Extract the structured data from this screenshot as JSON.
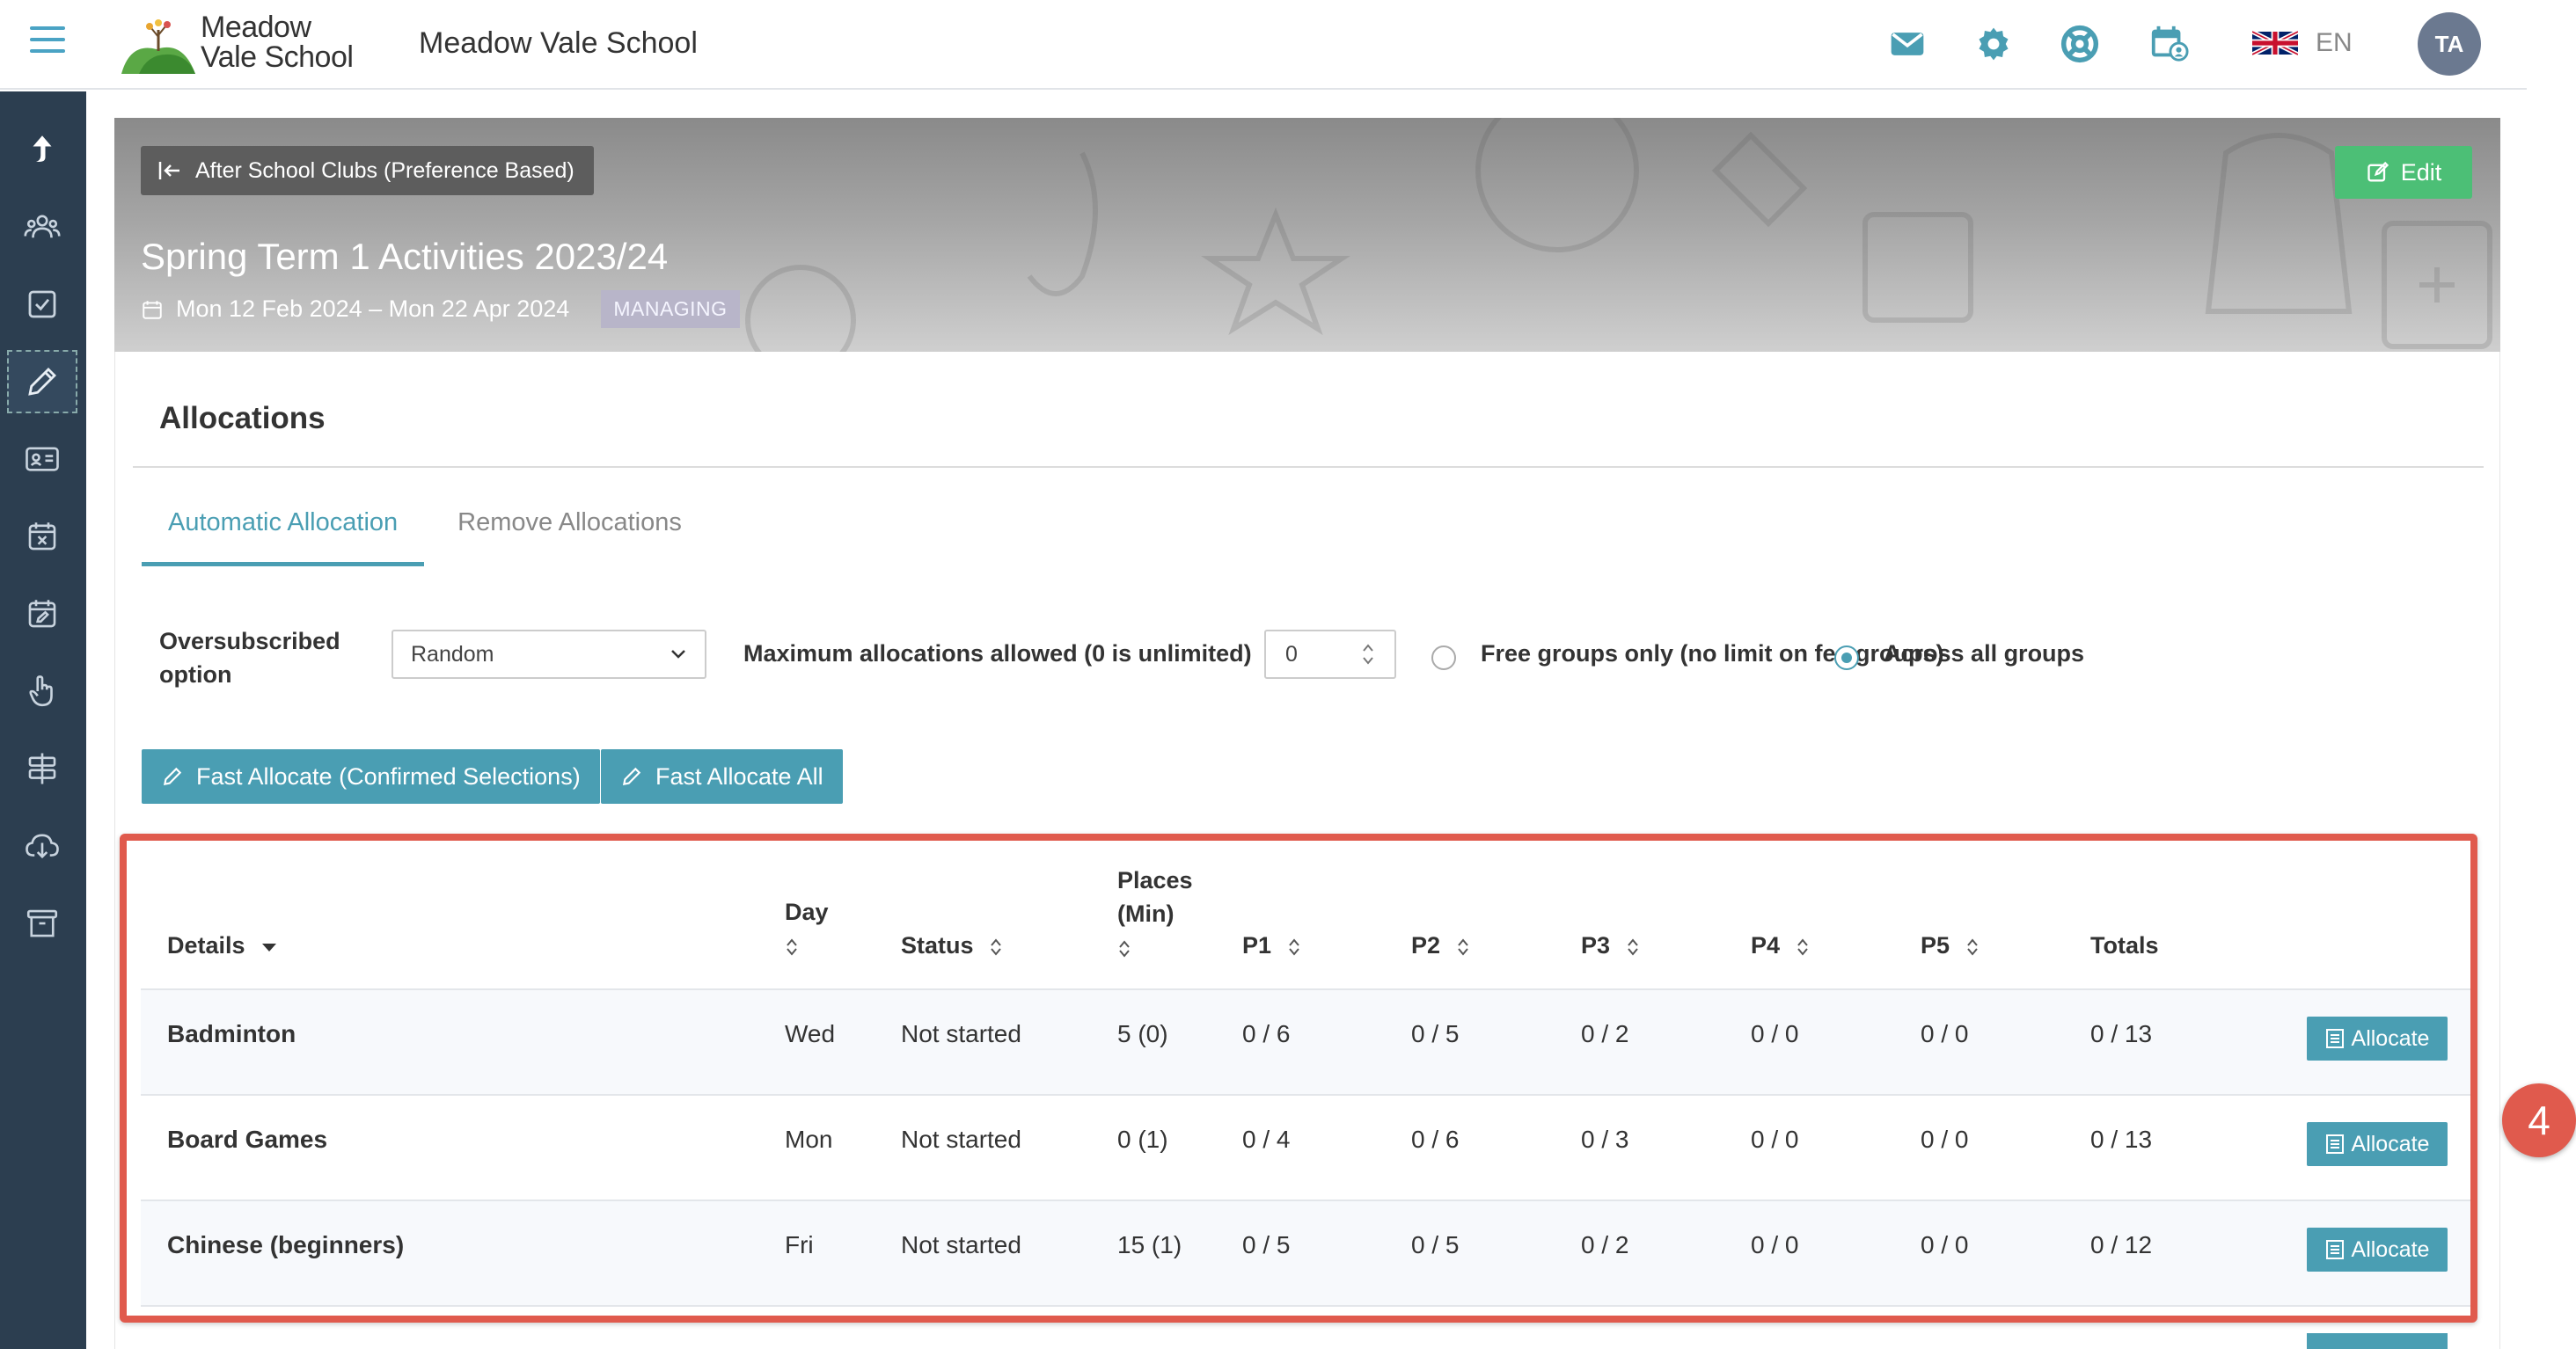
{
  "app": {
    "logo_line1": "Meadow",
    "logo_line2": "Vale School",
    "school_name": "Meadow Vale School",
    "language": "EN",
    "avatar_initials": "TA"
  },
  "banner": {
    "back_label": "After School Clubs (Preference Based)",
    "edit_label": "Edit",
    "title": "Spring Term 1 Activities 2023/24",
    "date_range": "Mon 12 Feb 2024 – Mon 22 Apr 2024",
    "status_badge": "MANAGING"
  },
  "allocations": {
    "section_title": "Allocations",
    "tabs": [
      {
        "label": "Automatic Allocation",
        "active": true
      },
      {
        "label": "Remove Allocations",
        "active": false
      }
    ],
    "oversubscribed_label_line1": "Oversubscribed",
    "oversubscribed_label_line2": "option",
    "oversubscribed_value": "Random",
    "max_label": "Maximum allocations allowed (0 is unlimited)",
    "max_value": "0",
    "radio_free_label": "Free groups only (no limit on fee groups)",
    "radio_across_label": "Across all groups",
    "selected_radio": "Across all groups",
    "fast_confirmed_label": "Fast Allocate (Confirmed Selections)",
    "fast_all_label": "Fast Allocate All"
  },
  "table": {
    "headers": {
      "details": "Details",
      "day": "Day",
      "status": "Status",
      "places_line1": "Places",
      "places_line2": "(Min)",
      "p1": "P1",
      "p2": "P2",
      "p3": "P3",
      "p4": "P4",
      "p5": "P5",
      "totals": "Totals"
    },
    "rows": [
      {
        "name": "Badminton",
        "day": "Wed",
        "status": "Not started",
        "places": "5 (0)",
        "p1": "0 / 6",
        "p2": "0 / 5",
        "p3": "0 / 2",
        "p4": "0 / 0",
        "p5": "0 / 0",
        "totals": "0 / 13",
        "action": "Allocate"
      },
      {
        "name": "Board Games",
        "day": "Mon",
        "status": "Not started",
        "places": "0 (1)",
        "p1": "0 / 4",
        "p2": "0 / 6",
        "p3": "0 / 3",
        "p4": "0 / 0",
        "p5": "0 / 0",
        "totals": "0 / 13",
        "action": "Allocate"
      },
      {
        "name": "Chinese (beginners)",
        "day": "Fri",
        "status": "Not started",
        "places": "15 (1)",
        "p1": "0 / 5",
        "p2": "0 / 5",
        "p3": "0 / 2",
        "p4": "0 / 0",
        "p5": "0 / 0",
        "totals": "0 / 12",
        "action": "Allocate"
      }
    ]
  },
  "step_marker": "4",
  "colors": {
    "accent": "#4a9eb3",
    "sidebar": "#2c3e50",
    "edit": "#4cbf76",
    "highlight": "#e05a4d"
  },
  "icons": {
    "top": [
      "mail-icon",
      "settings-icon",
      "support-icon",
      "calendar-user-icon"
    ],
    "sidebar": [
      "share-icon",
      "people-icon",
      "checkbox-icon",
      "pencil-icon",
      "id-card-icon",
      "calendar-x-icon",
      "calendar-edit-icon",
      "hand-pointer-icon",
      "signpost-icon",
      "cloud-download-icon",
      "archive-icon"
    ]
  }
}
